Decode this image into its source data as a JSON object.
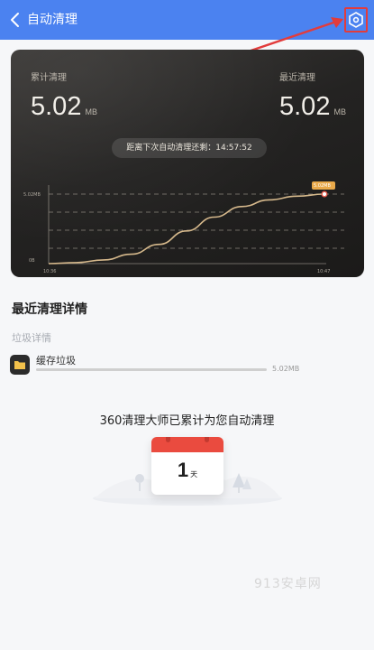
{
  "header": {
    "title": "自动清理",
    "back_icon": "back-chevron-icon",
    "settings_icon": "hexagon-gear-icon",
    "color": "#4b82f0"
  },
  "card": {
    "total_label": "累计清理",
    "total_value": "5.02",
    "total_unit": "MB",
    "recent_label": "最近清理",
    "recent_value": "5.02",
    "recent_unit": "MB",
    "countdown": "距离下次自动清理还剩：14:57:52",
    "chart_y_top_label": "5.02MB",
    "chart_y_bottom_label": "0B",
    "chart_x_start_label": "10:36",
    "chart_x_end_label": "10:47",
    "chart_point_label": "5.02MB"
  },
  "chart_data": {
    "type": "line",
    "x": [
      0,
      0.1,
      0.2,
      0.3,
      0.4,
      0.5,
      0.6,
      0.7,
      0.8,
      0.9,
      1.0
    ],
    "values": [
      0,
      0.07,
      0.27,
      0.68,
      1.39,
      2.36,
      3.36,
      4.12,
      4.6,
      4.87,
      5.02
    ],
    "x_ticks": [
      "10:36",
      "10:47"
    ],
    "y_ticks": [
      "0B",
      "5.02MB"
    ],
    "ylim": [
      0,
      5.02
    ],
    "series_color": "#d6b98c",
    "highlight_label": "5.02MB"
  },
  "details": {
    "title": "最近清理详情",
    "subtitle": "垃圾详情",
    "items": [
      {
        "label": "缓存垃圾",
        "size": "5.02MB",
        "icon": "folder-icon",
        "fill": 1.0
      }
    ]
  },
  "summary": {
    "text": "360清理大师已累计为您自动清理",
    "days": "1",
    "unit": "天"
  },
  "watermark": "913安卓网"
}
